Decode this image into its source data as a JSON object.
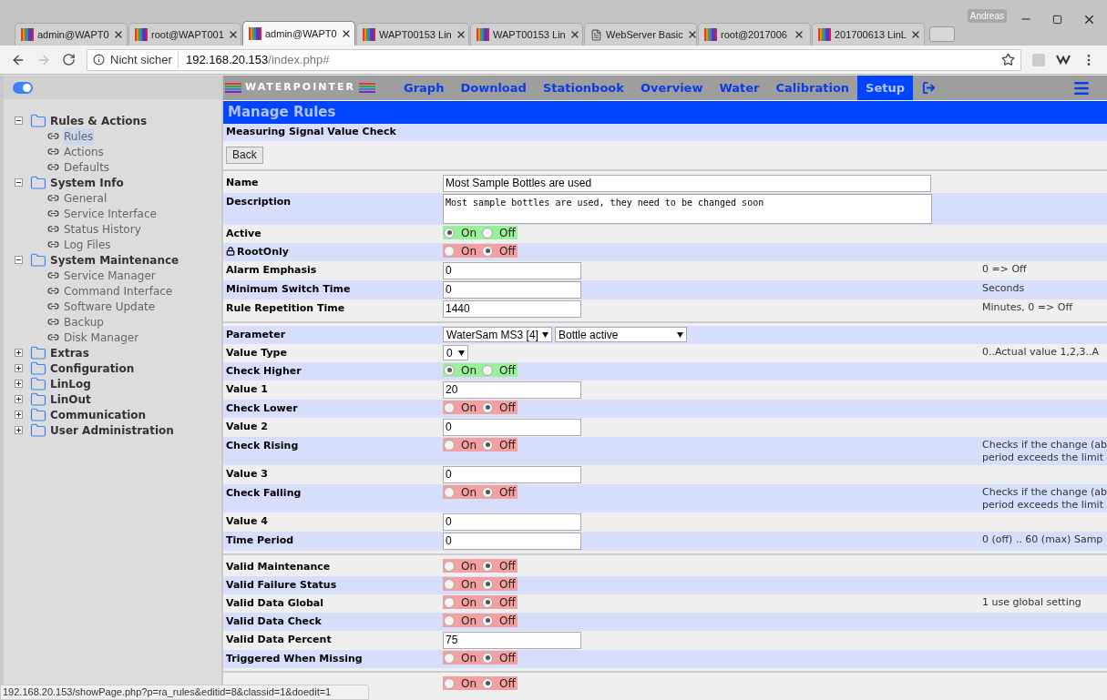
{
  "browser": {
    "tabs": [
      {
        "title": "admin@WAPT0",
        "kind": "bars",
        "selected": false
      },
      {
        "title": "root@WAPT001",
        "kind": "bars",
        "selected": false
      },
      {
        "title": "admin@WAPT0",
        "kind": "bars",
        "selected": true
      },
      {
        "title": "WAPT00153 Lin",
        "kind": "bars",
        "selected": false
      },
      {
        "title": "WAPT00153 Lin",
        "kind": "bars",
        "selected": false
      },
      {
        "title": "WebServer Basic",
        "kind": "page",
        "selected": false
      },
      {
        "title": "root@2017006",
        "kind": "bars",
        "selected": false
      },
      {
        "title": "201700613 LinL",
        "kind": "bars",
        "selected": false
      }
    ],
    "profile": "Andreas",
    "security": "Nicht sicher",
    "url_host": "192.168.20.153",
    "url_path": "/index.php#"
  },
  "sidebar": {
    "toggle": {
      "on": true
    },
    "items": [
      {
        "label": "Rules & Actions",
        "expanded": true,
        "children": [
          {
            "label": "Rules",
            "selected": true
          },
          {
            "label": "Actions",
            "selected": false
          },
          {
            "label": "Defaults",
            "selected": false
          }
        ]
      },
      {
        "label": "System Info",
        "expanded": true,
        "children": [
          {
            "label": "General",
            "selected": false
          },
          {
            "label": "Service Interface",
            "selected": false
          },
          {
            "label": "Status History",
            "selected": false
          },
          {
            "label": "Log Files",
            "selected": false
          }
        ]
      },
      {
        "label": "System Maintenance",
        "expanded": true,
        "children": [
          {
            "label": "Service Manager",
            "selected": false
          },
          {
            "label": "Command Interface",
            "selected": false
          },
          {
            "label": "Software Update",
            "selected": false
          },
          {
            "label": "Backup",
            "selected": false
          },
          {
            "label": "Disk Manager",
            "selected": false
          }
        ]
      },
      {
        "label": "Extras",
        "expanded": false
      },
      {
        "label": "Configuration",
        "expanded": false
      },
      {
        "label": "LinLog",
        "expanded": false
      },
      {
        "label": "LinOut",
        "expanded": false
      },
      {
        "label": "Communication",
        "expanded": false
      },
      {
        "label": "User Administration",
        "expanded": false
      }
    ]
  },
  "nav": {
    "logo": "WATERPOINTER",
    "items": [
      {
        "label": "Graph",
        "selected": false
      },
      {
        "label": "Download",
        "selected": false
      },
      {
        "label": "Stationbook",
        "selected": false
      },
      {
        "label": "Overview",
        "selected": false
      },
      {
        "label": "Water",
        "selected": false
      },
      {
        "label": "Calibration",
        "selected": false
      },
      {
        "label": "Setup",
        "selected": true
      }
    ]
  },
  "header": "Manage Rules",
  "subtitle": "Measuring Signal Value Check",
  "back_button": "Back",
  "sections": [
    [
      {
        "label": "Name",
        "kind": "wide",
        "value": "Most Sample Bottles are used"
      },
      {
        "label": "Description",
        "kind": "textarea",
        "value": "Most sample bottles are used, they need to be changed soon"
      },
      {
        "label": "Active",
        "kind": "toggle",
        "on": true,
        "on_label": "On",
        "off_label": "Off"
      },
      {
        "label": "RootOnly",
        "kind": "toggle",
        "locked": true,
        "on": false,
        "on_label": "On",
        "off_label": "Off"
      },
      {
        "label": "Alarm Emphasis",
        "kind": "input",
        "value": "0",
        "hint_lines": [
          "0 => Off"
        ]
      },
      {
        "label": "Minimum Switch Time",
        "kind": "input",
        "value": "0",
        "hint_lines": [
          "Seconds"
        ]
      },
      {
        "label": "Rule Repetition Time",
        "kind": "input",
        "value": "1440",
        "hint_lines": [
          "Minutes, 0 => Off"
        ]
      }
    ],
    [
      {
        "label": "Parameter",
        "kind": "selects",
        "values": [
          "WaterSam MS3 [4]",
          "Bottle active"
        ]
      },
      {
        "label": "Value Type",
        "kind": "select",
        "value": "0",
        "hint_lines": [
          "0..Actual value 1,2,3..A"
        ]
      },
      {
        "label": "Check Higher",
        "kind": "toggle",
        "on": true,
        "on_label": "On",
        "off_label": "Off"
      },
      {
        "label": "Value 1",
        "kind": "input",
        "value": "20"
      },
      {
        "label": "Check Lower",
        "kind": "toggle",
        "on": false,
        "on_label": "On",
        "off_label": "Off"
      },
      {
        "label": "Value 2",
        "kind": "input",
        "value": "0"
      },
      {
        "label": "Check Rising",
        "kind": "toggle",
        "on": false,
        "on_label": "On",
        "off_label": "Off",
        "hint_lines": [
          "Checks if the change (ab",
          "period exceeds the limit"
        ]
      },
      {
        "label": "Value 3",
        "kind": "input",
        "value": "0"
      },
      {
        "label": "Check Falling",
        "kind": "toggle",
        "on": false,
        "on_label": "On",
        "off_label": "Off",
        "hint_lines": [
          "Checks if the change (ab",
          "period exceeds the limit"
        ]
      },
      {
        "label": "Value 4",
        "kind": "input",
        "value": "0"
      },
      {
        "label": "Time Period",
        "kind": "input",
        "value": "0",
        "hint_lines": [
          "0 (off) .. 60 (max) Samp"
        ]
      }
    ],
    [
      {
        "label": "Valid Maintenance",
        "kind": "toggle",
        "on": false,
        "on_label": "On",
        "off_label": "Off"
      },
      {
        "label": "Valid Failure Status",
        "kind": "toggle",
        "on": false,
        "on_label": "On",
        "off_label": "Off"
      },
      {
        "label": "Valid Data Global",
        "kind": "toggle",
        "on": false,
        "on_label": "On",
        "off_label": "Off",
        "hint_lines": [
          "1 use global setting"
        ]
      },
      {
        "label": "Valid Data Check",
        "kind": "toggle",
        "on": false,
        "on_label": "On",
        "off_label": "Off"
      },
      {
        "label": "Valid Data Percent",
        "kind": "input",
        "value": "75"
      },
      {
        "label": "Triggered When Missing",
        "kind": "toggle",
        "on": false,
        "on_label": "On",
        "off_label": "Off"
      }
    ],
    [
      {
        "kind": "toggle",
        "on": false,
        "on_label": "On",
        "off_label": "Off"
      }
    ]
  ],
  "status_bar": "192.168.20.153/showPage.php?p=ra_rules&editid=8&classid=1&doedit=1"
}
